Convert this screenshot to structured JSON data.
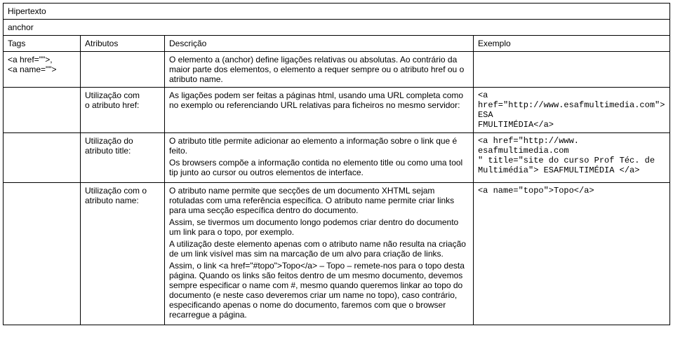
{
  "title": "Hipertexto",
  "section": "anchor",
  "columns": {
    "tags": "Tags",
    "attrs": "Atributos",
    "desc": "Descrição",
    "example": "Exemplo"
  },
  "row_main": {
    "tags_line1": "<a href=\"\">,",
    "tags_line2": "<a name=\"\">",
    "desc": "O elemento a (anchor) define ligações relativas ou absolutas. Ao contrário da maior parte dos elementos, o elemento a requer sempre ou o atributo href ou o atributo name."
  },
  "row_href": {
    "attr_line1": "Utilização com",
    "attr_line2": "o atributo href:",
    "desc": "As ligações podem ser feitas a páginas html, usando uma URL completa como no exemplo ou referenciando URL relativas para ficheiros no mesmo servidor:",
    "ex_line1": "<a",
    "ex_line2": "href=\"http://www.esafmultimedia.com\">ESA",
    "ex_line3": "FMULTIMÉDIA</a>"
  },
  "row_title": {
    "attr_line1": "Utilização do",
    "attr_line2": "atributo title:",
    "desc_p1": "O atributo title permite adicionar ao elemento a informação sobre o link que é feito.",
    "desc_p2": "Os browsers compõe a informação contida no elemento title ou como uma tool tip junto ao cursor ou outros elementos de interface.",
    "ex_line1": "<a href=\"http://www. esafmultimedia.com",
    "ex_line2": "\" title=\"site do curso Prof Téc. de",
    "ex_line3": "Multimédia\"> ESAFMULTIMÉDIA </a>"
  },
  "row_name": {
    "attr_line1": "Utilização com o",
    "attr_line2": "atributo name:",
    "desc_p1": "O atributo name permite que secções de um documento XHTML sejam rotuladas com uma referência específica. O atributo name permite criar links para uma secção específica dentro do documento.",
    "desc_p2": "Assim, se tivermos um documento longo podemos criar dentro do documento um link para o topo, por exemplo.",
    "desc_p3": "A utilização deste elemento apenas com o atributo name não resulta na criação de um link visível mas sim na marcação de um alvo para criação de links.",
    "desc_p4": "Assim, o link <a href=\"#topo\">Topo</a> – Topo – remete-nos para o topo desta página. Quando os links são feitos dentro de um mesmo documento, devemos sempre especificar o name com #, mesmo quando queremos linkar ao topo do documento (e neste caso deveremos criar um name no topo), caso contrário, especificando apenas o nome do documento, faremos com que o browser recarregue a página.",
    "ex": "<a name=\"topo\">Topo</a>"
  }
}
